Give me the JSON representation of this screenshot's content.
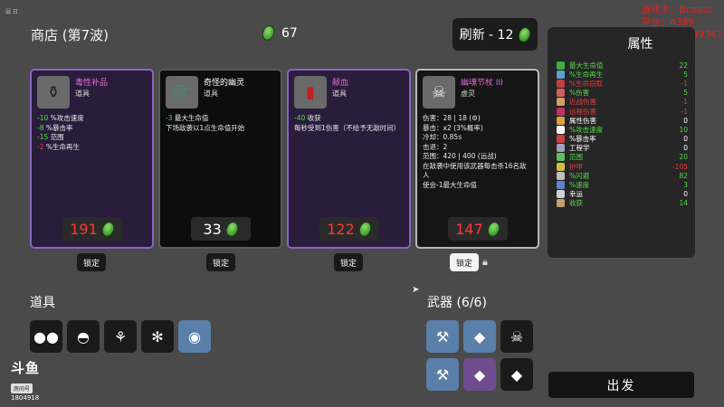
{
  "overlay": {
    "top_left": "弱 日",
    "streamer": "游戏主：Bcoato",
    "platform": "平台：4399",
    "group": "Q群：372999347"
  },
  "shop": {
    "title": "商店 (第7波)",
    "materials": "67",
    "refresh_label": "刷新 - 12"
  },
  "cards": [
    {
      "name": "毒性补品",
      "type": "道具",
      "icon": "potion-icon",
      "effects": [
        {
          "val": "-10",
          "cls": "g",
          "text": " %攻击速度"
        },
        {
          "val": "-8",
          "cls": "g",
          "text": " %暴击率"
        },
        {
          "val": "-15",
          "cls": "g",
          "text": " 范围"
        },
        {
          "val": "-2",
          "cls": "r",
          "text": " %生命再生"
        }
      ],
      "price": "191",
      "price_color": "red",
      "lock": "锁定"
    },
    {
      "name": "奇怪的幽灵",
      "type": "道具",
      "icon": "ghost-icon",
      "effects": [
        {
          "val": "-3",
          "cls": "g",
          "text": " 最大生命值"
        },
        {
          "val": "",
          "cls": "",
          "text": "下场敌袭以1点生命值开始"
        }
      ],
      "price": "33",
      "price_color": "white",
      "lock": "锁定"
    },
    {
      "name": "献血",
      "type": "道具",
      "icon": "blood-bag-icon",
      "effects": [
        {
          "val": "-40",
          "cls": "g",
          "text": " 收获"
        },
        {
          "val": "",
          "cls": "",
          "text": "每秒受到1伤害（不给予无敌时间）"
        }
      ],
      "price": "122",
      "price_color": "red",
      "lock": "锁定"
    },
    {
      "name": "幽魂节杖 III",
      "type": "虚灵",
      "icon": "ghost-scepter-icon",
      "effects": [
        {
          "val": "",
          "cls": "",
          "text": "伤害：28 | 18 (⚙)"
        },
        {
          "val": "",
          "cls": "",
          "text": "暴击：x2 (3%概率)"
        },
        {
          "val": "",
          "cls": "",
          "text": "冷却：0.85s"
        },
        {
          "val": "",
          "cls": "",
          "text": "击退：2"
        },
        {
          "val": "",
          "cls": "",
          "text": "范围：420 | 400 (远战)"
        },
        {
          "val": "",
          "cls": "",
          "text": "在敌袭中使用该武器每击杀16名敌人"
        },
        {
          "val": "",
          "cls": "",
          "text": "使会-1最大生命值"
        }
      ],
      "price": "147",
      "price_color": "red",
      "lock": "锁定"
    }
  ],
  "stats": {
    "title": "属性",
    "rows": [
      {
        "label": "最大生命值",
        "value": "22",
        "color": "#55d94a",
        "icon_color": "#3fb040"
      },
      {
        "label": "%生命再生",
        "value": "5",
        "color": "#55d94a",
        "icon_color": "#5aa0d0"
      },
      {
        "label": "%生命窃取",
        "value": "-1",
        "color": "#e23b3b",
        "icon_color": "#c04040"
      },
      {
        "label": "%伤害",
        "value": "5",
        "color": "#55d94a",
        "icon_color": "#d06060"
      },
      {
        "label": "近战伤害",
        "value": "-1",
        "color": "#e23b3b",
        "icon_color": "#d0a060"
      },
      {
        "label": "远程伤害",
        "value": "-1",
        "color": "#e23b3b",
        "icon_color": "#c03060"
      },
      {
        "label": "属性伤害",
        "value": "0",
        "color": "#ffffff",
        "icon_color": "#e0a040"
      },
      {
        "label": "%攻击速度",
        "value": "10",
        "color": "#55d94a",
        "icon_color": "#ffffff"
      },
      {
        "label": "%暴击率",
        "value": "0",
        "color": "#ffffff",
        "icon_color": "#d04040"
      },
      {
        "label": "工程学",
        "value": "0",
        "color": "#ffffff",
        "icon_color": "#a0a0c0"
      },
      {
        "label": "范围",
        "value": "20",
        "color": "#55d94a",
        "icon_color": "#60c060"
      },
      {
        "label": "护甲",
        "value": "-105",
        "color": "#e23b3b",
        "icon_color": "#d0c040"
      },
      {
        "label": "%闪避",
        "value": "82",
        "color": "#55d94a",
        "icon_color": "#c0c0c0"
      },
      {
        "label": "%速度",
        "value": "3",
        "color": "#55d94a",
        "icon_color": "#6080d0"
      },
      {
        "label": "幸运",
        "value": "0",
        "color": "#ffffff",
        "icon_color": "#d0d0d0"
      },
      {
        "label": "收获",
        "value": "14",
        "color": "#55d94a",
        "icon_color": "#c0a070"
      }
    ]
  },
  "items": {
    "title": "道具",
    "slots": [
      {
        "name": "goggles-icon",
        "glyph": "●●",
        "style": ""
      },
      {
        "name": "duck-icon",
        "glyph": "◓",
        "style": ""
      },
      {
        "name": "sprout-icon",
        "glyph": "⚘",
        "style": ""
      },
      {
        "name": "bee-icon",
        "glyph": "✻",
        "style": ""
      },
      {
        "name": "egg-icon",
        "glyph": "◉",
        "style": "blue"
      }
    ]
  },
  "weapons": {
    "title": "武器 (6/6)",
    "slots": [
      {
        "name": "axe-weapon-icon",
        "glyph": "⚒",
        "style": "blue"
      },
      {
        "name": "crystal-weapon-icon",
        "glyph": "◆",
        "style": "blue"
      },
      {
        "name": "scepter-weapon-icon",
        "glyph": "☠",
        "style": ""
      },
      {
        "name": "axe-weapon-icon",
        "glyph": "⚒",
        "style": "blue"
      },
      {
        "name": "crystal-weapon-icon",
        "glyph": "◆",
        "style": "purple"
      },
      {
        "name": "crystal-weapon-icon",
        "glyph": "◆",
        "style": ""
      }
    ]
  },
  "go_label": "出发",
  "logo": {
    "main": "斗鱼",
    "sub": "房间号",
    "room_id": "1804918"
  }
}
